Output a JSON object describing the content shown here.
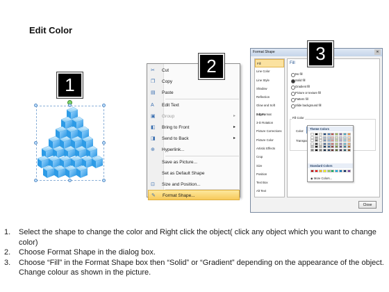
{
  "page": {
    "title": "Edit Color"
  },
  "badges": {
    "one": "1",
    "two": "2",
    "three": "3"
  },
  "context_menu": {
    "items": [
      {
        "label": "Cut",
        "icon": "scissors-icon",
        "state": "normal"
      },
      {
        "label": "Copy",
        "icon": "copy-icon",
        "state": "normal"
      },
      {
        "label": "Paste",
        "icon": "paste-icon",
        "state": "normal"
      },
      {
        "label": "Edit Text",
        "icon": "edit-text-icon",
        "state": "normal"
      },
      {
        "label": "Group",
        "icon": "group-icon",
        "state": "disabled",
        "submenu": true
      },
      {
        "label": "Bring to Front",
        "icon": "bring-to-front-icon",
        "state": "normal",
        "submenu": true
      },
      {
        "label": "Send to Back",
        "icon": "send-to-back-icon",
        "state": "normal",
        "submenu": true
      },
      {
        "label": "Hyperlink...",
        "icon": "hyperlink-icon",
        "state": "normal"
      },
      {
        "label": "Save as Picture...",
        "icon": "",
        "state": "normal"
      },
      {
        "label": "Set as Default Shape",
        "icon": "",
        "state": "normal"
      },
      {
        "label": "Size and Position...",
        "icon": "size-position-icon",
        "state": "normal"
      },
      {
        "label": "Format Shape...",
        "icon": "format-shape-icon",
        "state": "highlighted"
      }
    ]
  },
  "format_dialog": {
    "title": "Format Shape",
    "categories": [
      "Fill",
      "Line Color",
      "Line Style",
      "Shadow",
      "Reflection",
      "Glow and Soft Edges",
      "3-D Format",
      "3-D Rotation",
      "Picture Corrections",
      "Picture Color",
      "Artistic Effects",
      "Crop",
      "Size",
      "Position",
      "Text Box",
      "Alt Text"
    ],
    "selected_category": "Fill",
    "fill_heading": "Fill",
    "fill_options": [
      "No fill",
      "Solid fill",
      "Gradient fill",
      "Picture or texture fill",
      "Pattern fill",
      "Slide background fill"
    ],
    "selected_fill_option": "Solid fill",
    "fill_color_group_label": "Fill Color",
    "color_label": "Color:",
    "transparency_label": "Transpa",
    "close_label": "Close"
  },
  "color_palette": {
    "theme_header": "Theme Colors",
    "standard_header": "Standard Colors",
    "more_colors": "More Colors...",
    "theme_top_row": [
      "#ffffff",
      "#000000",
      "#eeece1",
      "#1f497d",
      "#4f81bd",
      "#c0504d",
      "#9bbb59",
      "#8064a2",
      "#4bacc6",
      "#f79646"
    ],
    "standard_row": [
      "#c00000",
      "#ff0000",
      "#ffc000",
      "#ffff00",
      "#92d050",
      "#00b050",
      "#00b0f0",
      "#0070c0",
      "#002060",
      "#7030a0"
    ]
  },
  "instructions": [
    {
      "num": "1.",
      "text": "Select the shape to change the color and Right click the object( click any object which you want to change color)"
    },
    {
      "num": "2.",
      "text": "Choose Format Shape in the dialog box."
    },
    {
      "num": "3.",
      "text": "Choose “Fill” in the Format Shape box then “Solid” or “Gradient” depending on the appearance of the object. Change colour as shown in the picture."
    }
  ]
}
